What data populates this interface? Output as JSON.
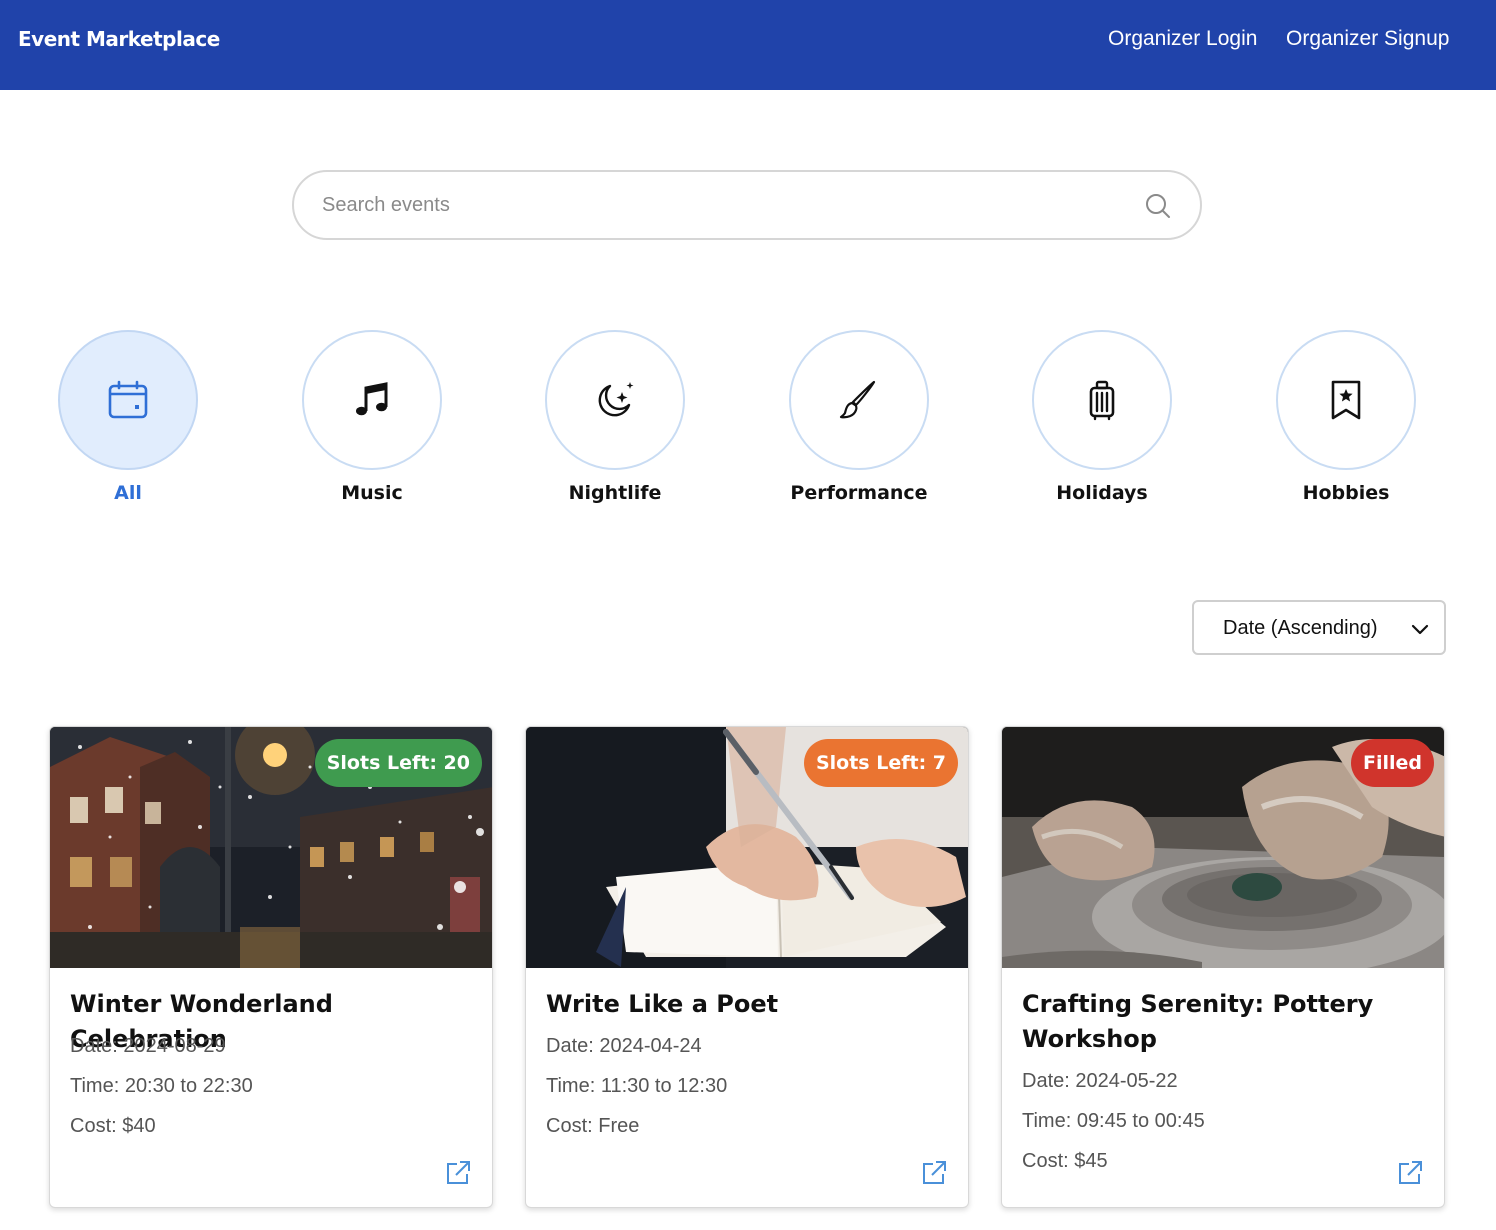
{
  "header": {
    "brand": "Event Marketplace",
    "nav": {
      "login": "Organizer Login",
      "signup": "Organizer Signup"
    },
    "background_color": "#2043aa"
  },
  "search": {
    "placeholder": "Search events",
    "value": "",
    "icon": "search-icon"
  },
  "categories": [
    {
      "label": "All",
      "icon": "calendar-icon",
      "active": true
    },
    {
      "label": "Music",
      "icon": "music-note-icon",
      "active": false
    },
    {
      "label": "Nightlife",
      "icon": "moon-stars-icon",
      "active": false
    },
    {
      "label": "Performance",
      "icon": "paintbrush-icon",
      "active": false
    },
    {
      "label": "Holidays",
      "icon": "suitcase-icon",
      "active": false
    },
    {
      "label": "Hobbies",
      "icon": "bookmark-star-icon",
      "active": false
    }
  ],
  "sort": {
    "selected": "Date (Ascending)",
    "icon": "chevron-down-icon"
  },
  "events": [
    {
      "title": "Winter Wonderland Celebration",
      "badge": "Slots Left: 20",
      "badge_color": "#3f9b4f",
      "date": "Date: 2024-08-29",
      "time": "Time: 20:30 to 22:30",
      "cost": "Cost: $40",
      "image": "snowy-street-night"
    },
    {
      "title": "Write Like a Poet",
      "badge": "Slots Left: 7",
      "badge_color": "#ea7431",
      "date": "Date: 2024-04-24",
      "time": "Time: 11:30 to 12:30",
      "cost": "Cost: Free",
      "image": "hand-writing-notebook"
    },
    {
      "title": "Crafting Serenity: Pottery Workshop",
      "badge": "Filled",
      "badge_color": "#d0342c",
      "date": "Date: 2024-05-22",
      "time": "Time: 09:45 to 00:45",
      "cost": "Cost: $45",
      "image": "pottery-wheel-hands"
    }
  ],
  "colors": {
    "accent": "#2f6fd6",
    "active_category_bg": "#e1edfd",
    "link_icon": "#4a90d9"
  }
}
